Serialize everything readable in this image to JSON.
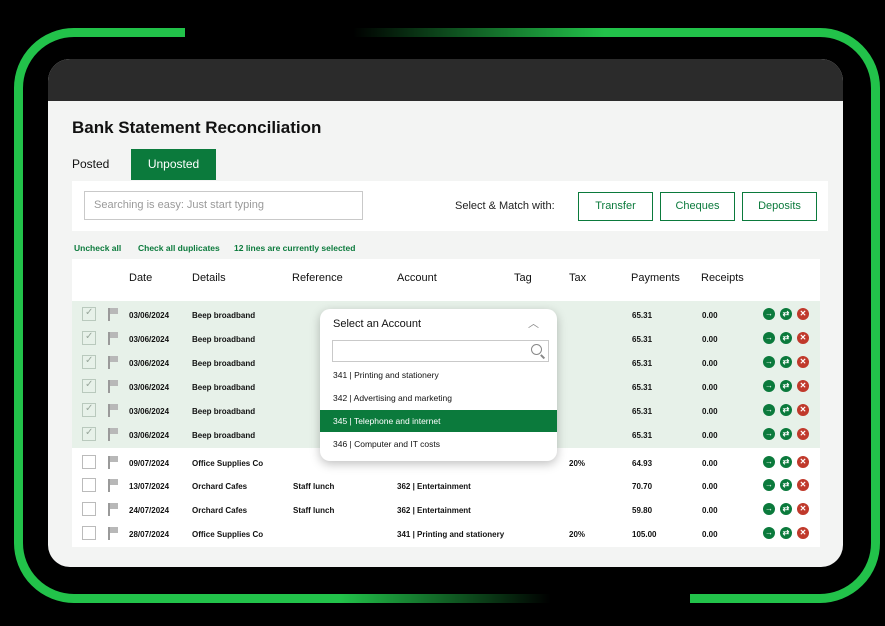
{
  "app": {
    "title": "Bank Statement Reconciliation",
    "tabs": [
      {
        "label": "Posted",
        "active": false
      },
      {
        "label": "Unposted",
        "active": true
      }
    ]
  },
  "toolbar": {
    "search_placeholder": "Searching is easy: Just start typing",
    "match_label": "Select & Match with:",
    "buttons": [
      "Transfer",
      "Cheques",
      "Deposits"
    ]
  },
  "links": {
    "uncheck_all": "Uncheck all",
    "check_duplicates": "Check all duplicates",
    "selected_status": "12 lines are currently selected"
  },
  "table": {
    "headers": [
      "Date",
      "Details",
      "Reference",
      "Account",
      "Tag",
      "Tax",
      "Payments",
      "Receipts"
    ],
    "rows": [
      {
        "checked": true,
        "date": "03/06/2024",
        "details": "Beep broadband",
        "reference": "",
        "account": "",
        "tax": "",
        "payments": "65.31",
        "receipts": "0.00"
      },
      {
        "checked": true,
        "date": "03/06/2024",
        "details": "Beep broadband",
        "reference": "",
        "account": "",
        "tax": "",
        "payments": "65.31",
        "receipts": "0.00"
      },
      {
        "checked": true,
        "date": "03/06/2024",
        "details": "Beep broadband",
        "reference": "",
        "account": "",
        "tax": "",
        "payments": "65.31",
        "receipts": "0.00"
      },
      {
        "checked": true,
        "date": "03/06/2024",
        "details": "Beep broadband",
        "reference": "",
        "account": "",
        "tax": "",
        "payments": "65.31",
        "receipts": "0.00"
      },
      {
        "checked": true,
        "date": "03/06/2024",
        "details": "Beep broadband",
        "reference": "",
        "account": "",
        "tax": "",
        "payments": "65.31",
        "receipts": "0.00"
      },
      {
        "checked": true,
        "date": "03/06/2024",
        "details": "Beep broadband",
        "reference": "",
        "account": "",
        "tax": "",
        "payments": "65.31",
        "receipts": "0.00"
      },
      {
        "checked": false,
        "date": "09/07/2024",
        "details": "Office Supplies Co",
        "reference": "",
        "account": "",
        "tax": "20%",
        "payments": "64.93",
        "receipts": "0.00"
      },
      {
        "checked": false,
        "date": "13/07/2024",
        "details": "Orchard Cafes",
        "reference": "Staff lunch",
        "account": "362 | Entertainment",
        "tax": "",
        "payments": "70.70",
        "receipts": "0.00"
      },
      {
        "checked": false,
        "date": "24/07/2024",
        "details": "Orchard Cafes",
        "reference": "Staff lunch",
        "account": "362 | Entertainment",
        "tax": "",
        "payments": "59.80",
        "receipts": "0.00"
      },
      {
        "checked": false,
        "date": "28/07/2024",
        "details": "Office Supplies Co",
        "reference": "",
        "account": "341 | Printing and stationery",
        "tax": "20%",
        "payments": "105.00",
        "receipts": "0.00"
      }
    ],
    "row_actions": [
      "arrow-right-icon",
      "match-icon",
      "delete-icon"
    ]
  },
  "dropdown": {
    "title": "Select an Account",
    "search_value": "",
    "options": [
      {
        "label": "341 | Printing and stationery",
        "active": false
      },
      {
        "label": "342 | Advertising and marketing",
        "active": false
      },
      {
        "label": "345 | Telephone and internet",
        "active": true
      },
      {
        "label": "346 | Computer and IT costs",
        "active": false
      }
    ]
  },
  "colors": {
    "brand_green": "#0b7a3c",
    "frame_green": "#22c24a",
    "selected_row_bg": "#e7f1e9",
    "delete_red": "#c0392b"
  }
}
